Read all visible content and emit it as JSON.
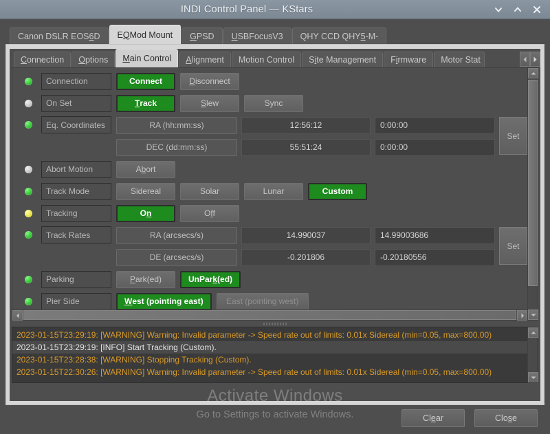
{
  "window": {
    "title": "INDI Control Panel — KStars",
    "controls": [
      {
        "name": "minimize",
        "icon": "chevron-down-icon"
      },
      {
        "name": "maximize",
        "icon": "chevron-up-icon"
      },
      {
        "name": "close",
        "icon": "close-icon"
      }
    ]
  },
  "device_tabs": [
    {
      "label": "Canon DSLR EOS 6D",
      "selected": false,
      "mnemonic": "6"
    },
    {
      "label": "EQMod Mount",
      "selected": true,
      "mnemonic": "Q"
    },
    {
      "label": "GPSD",
      "selected": false,
      "mnemonic": "G"
    },
    {
      "label": "USBFocusV3",
      "selected": false,
      "mnemonic": "U"
    },
    {
      "label": "QHY CCD QHY5-M-",
      "selected": false,
      "mnemonic": "5"
    }
  ],
  "property_tabs": [
    {
      "label": "Connection",
      "selected": false,
      "mnemonic": "C"
    },
    {
      "label": "Options",
      "selected": false,
      "mnemonic": "O"
    },
    {
      "label": "Main Control",
      "selected": true,
      "mnemonic": "M"
    },
    {
      "label": "Alignment",
      "selected": false,
      "mnemonic": "A"
    },
    {
      "label": "Motion Control",
      "selected": false,
      "mnemonic": ""
    },
    {
      "label": "Site Management",
      "selected": false,
      "mnemonic": "i"
    },
    {
      "label": "Firmware",
      "selected": false,
      "mnemonic": "i"
    },
    {
      "label": "Motor Stat",
      "selected": false,
      "mnemonic": ""
    }
  ],
  "main_control": {
    "connection": {
      "led": "green",
      "label": "Connection",
      "buttons": [
        {
          "label": "Connect",
          "state": "on",
          "mnemonic": ""
        },
        {
          "label": "Disconnect",
          "state": "off",
          "mnemonic": "D"
        }
      ]
    },
    "on_set": {
      "led": "grey",
      "label": "On Set",
      "buttons": [
        {
          "label": "Track",
          "state": "on",
          "mnemonic": "T"
        },
        {
          "label": "Slew",
          "state": "off",
          "mnemonic": "S"
        },
        {
          "label": "Sync",
          "state": "off",
          "mnemonic": ""
        }
      ]
    },
    "eq_coordinates": {
      "led": "green",
      "label": "Eq. Coordinates",
      "set_label": "Set",
      "rows": [
        {
          "name": "RA (hh:mm:ss)",
          "value": "12:56:12",
          "edit": "0:00:00"
        },
        {
          "name": "DEC (dd:mm:ss)",
          "value": "55:51:24",
          "edit": "0:00:00"
        }
      ]
    },
    "abort_motion": {
      "led": "grey",
      "label": "Abort Motion",
      "buttons": [
        {
          "label": "Abort",
          "state": "off",
          "mnemonic": "b"
        }
      ]
    },
    "track_mode": {
      "led": "green",
      "label": "Track Mode",
      "buttons": [
        {
          "label": "Sidereal",
          "state": "off",
          "mnemonic": ""
        },
        {
          "label": "Solar",
          "state": "off",
          "mnemonic": ""
        },
        {
          "label": "Lunar",
          "state": "off",
          "mnemonic": ""
        },
        {
          "label": "Custom",
          "state": "on",
          "mnemonic": ""
        }
      ]
    },
    "tracking": {
      "led": "yellow",
      "label": "Tracking",
      "buttons": [
        {
          "label": "On",
          "state": "on",
          "mnemonic": "n"
        },
        {
          "label": "Off",
          "state": "off",
          "mnemonic": "f"
        }
      ]
    },
    "track_rates": {
      "led": "green",
      "label": "Track Rates",
      "set_label": "Set",
      "rows": [
        {
          "name": "RA (arcsecs/s)",
          "value": "14.990037",
          "edit": "14.99003686"
        },
        {
          "name": "DE (arcsecs/s)",
          "value": "-0.201806",
          "edit": "-0.20180556"
        }
      ]
    },
    "parking": {
      "led": "green",
      "label": "Parking",
      "buttons": [
        {
          "label": "Park(ed)",
          "state": "off",
          "mnemonic": "P"
        },
        {
          "label": "UnPark(ed)",
          "state": "on",
          "mnemonic": "k"
        }
      ]
    },
    "pier_side": {
      "led": "green",
      "label": "Pier Side",
      "buttons": [
        {
          "label": "West (pointing east)",
          "state": "on",
          "mnemonic": "W"
        },
        {
          "label": "East (pointing west)",
          "state": "disabled",
          "mnemonic": ""
        }
      ]
    }
  },
  "log": {
    "lines": [
      {
        "severity": "warning",
        "text": "2023-01-15T23:29:19: [WARNING] Warning: Invalid parameter -> Speed rate out of limits: 0.01x Sidereal (min=0.05, max=800.00)"
      },
      {
        "severity": "info",
        "text": "2023-01-15T23:29:19: [INFO] Start Tracking (Custom)."
      },
      {
        "severity": "warning",
        "text": "2023-01-15T23:28:38: [WARNING] Stopping Tracking (Custom)."
      },
      {
        "severity": "warning",
        "text": "2023-01-15T22:30:26: [WARNING] Warning: Invalid parameter -> Speed rate out of limits: 0.01x Sidereal (min=0.05, max=800.00)"
      }
    ]
  },
  "bottom_buttons": [
    {
      "label": "Clear",
      "mnemonic": "e"
    },
    {
      "label": "Close",
      "mnemonic": "s"
    }
  ],
  "watermark": {
    "title": "Activate Windows",
    "subtitle": "Go to Settings to activate Windows."
  },
  "colors": {
    "accent_green": "#1e8b1e",
    "warning_text": "#d99a28",
    "titlebar": "#8a97a3",
    "panel_bg": "#4e4e4e"
  }
}
